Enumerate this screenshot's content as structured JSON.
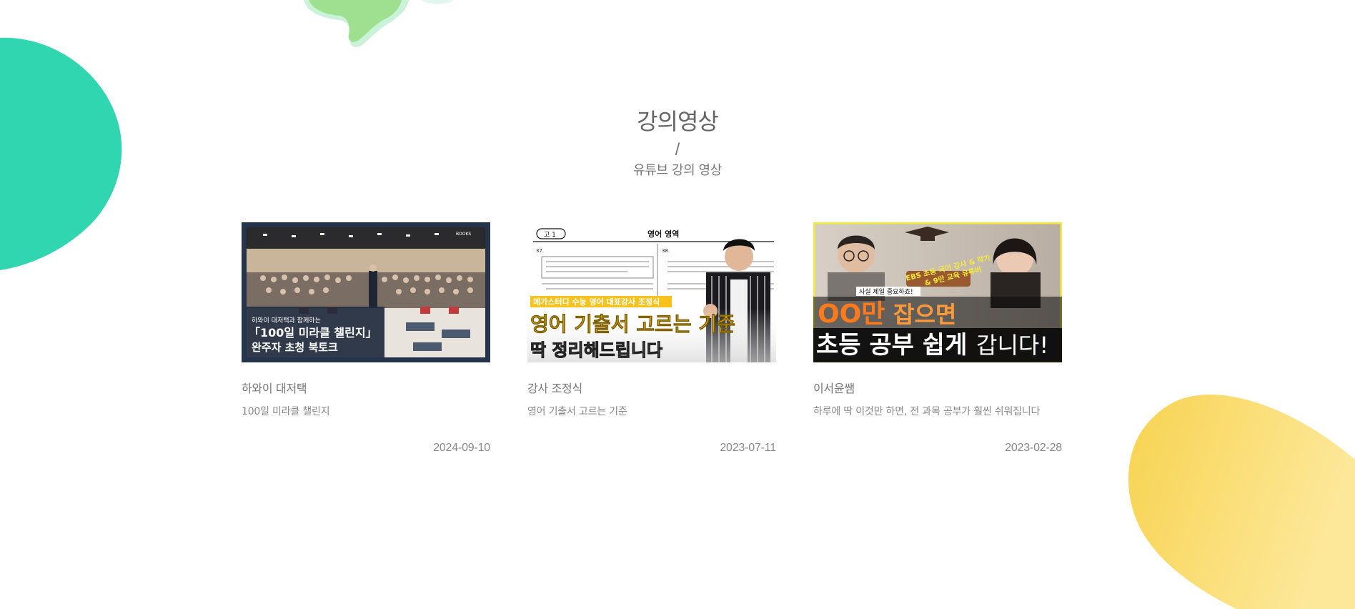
{
  "section": {
    "title": "강의영상",
    "divider": "/",
    "subtitle": "유튜브 강의 영상"
  },
  "colors": {
    "teal_blob": "#2fd6b0",
    "green_blob": "#9ee08f",
    "yellow_blob": "#f9da62"
  },
  "cards": [
    {
      "title": "하와이 대저택",
      "description": "100일 미라클 챌린지",
      "date": "2024-09-10",
      "thumbnail": {
        "brand": "BOOKS",
        "line1": "하와이 대저택과 함께하는",
        "line2": "「100일 미라클 챌린지」",
        "line3": "완주자 초청 북토크"
      }
    },
    {
      "title": "강사 조정식",
      "description": "영어 기출서 고르는 기준",
      "date": "2023-07-11",
      "thumbnail": {
        "grade": "고 1",
        "heading": "영어 영역",
        "q1": "37.",
        "q2": "38.",
        "caption": "메가스터디 수능 영어 대표강사 조정식",
        "main": "영어 기출서 고르는 기준",
        "sub": "딱 정리해드립니다"
      }
    },
    {
      "title": "이서윤쌤",
      "description": "하루에 딱 이것만 하면, 전 과목 공부가 훨씬 쉬워집니다",
      "date": "2023-02-28",
      "thumbnail": {
        "badge_line1": "EBS 초등 국어 강사 & 작가",
        "badge_line2": "& 9만 교육 유튜버",
        "small": "사실 제일 중요하죠!",
        "big1_orange": "OO만",
        "big1_white": "잡으면",
        "big2_white": "초등 공부 쉽게",
        "big2_tail": "갑니다!"
      }
    }
  ]
}
